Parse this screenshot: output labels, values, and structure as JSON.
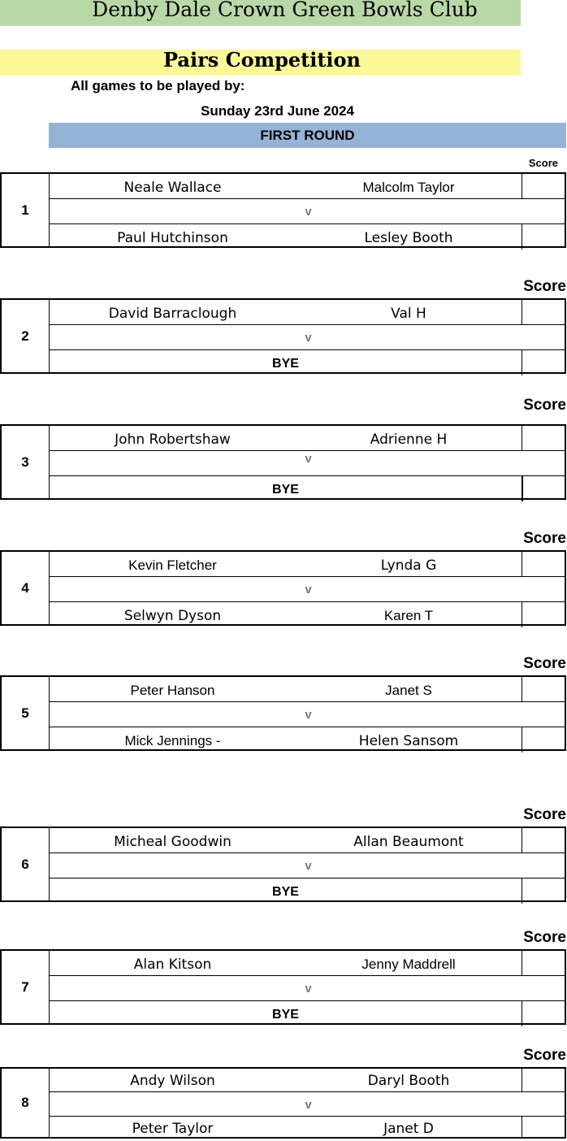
{
  "header": {
    "club": "Denby Dale Crown Green Bowls Club",
    "competition": "Pairs Competition",
    "played_by": "All games to be played by:",
    "date": "Sunday 23rd June 2024",
    "round": "FIRST ROUND",
    "score_label": "Score"
  },
  "vs_label": "v",
  "matches": [
    {
      "num": "1",
      "p1a": "Neale Wallace",
      "p1b": "Malcolm Taylor",
      "p2a": "Paul Hutchinson",
      "p2b": "Lesley Booth"
    },
    {
      "num": "2",
      "p1a": "David Barraclough",
      "p1b": "Val H",
      "bye": "BYE"
    },
    {
      "num": "3",
      "p1a": "John Robertshaw",
      "p1b": "Adrienne H",
      "bye": "BYE"
    },
    {
      "num": "4",
      "p1a": "Kevin Fletcher",
      "p1b": "Lynda G",
      "p2a": "Selwyn Dyson",
      "p2b": "Karen T"
    },
    {
      "num": "5",
      "p1a": "Peter Hanson",
      "p1b": "Janet S",
      "p2a": "Mick Jennings -",
      "p2b": "Helen Sansom"
    },
    {
      "num": "6",
      "p1a": "Micheal Goodwin",
      "p1b": "Allan Beaumont",
      "bye": "BYE"
    },
    {
      "num": "7",
      "p1a": "Alan Kitson",
      "p1b": "Jenny Maddrell",
      "bye": "BYE"
    },
    {
      "num": "8",
      "p1a": "Andy Wilson",
      "p1b": "Daryl Booth",
      "p2a": "Peter Taylor",
      "p2b": "Janet D"
    }
  ]
}
